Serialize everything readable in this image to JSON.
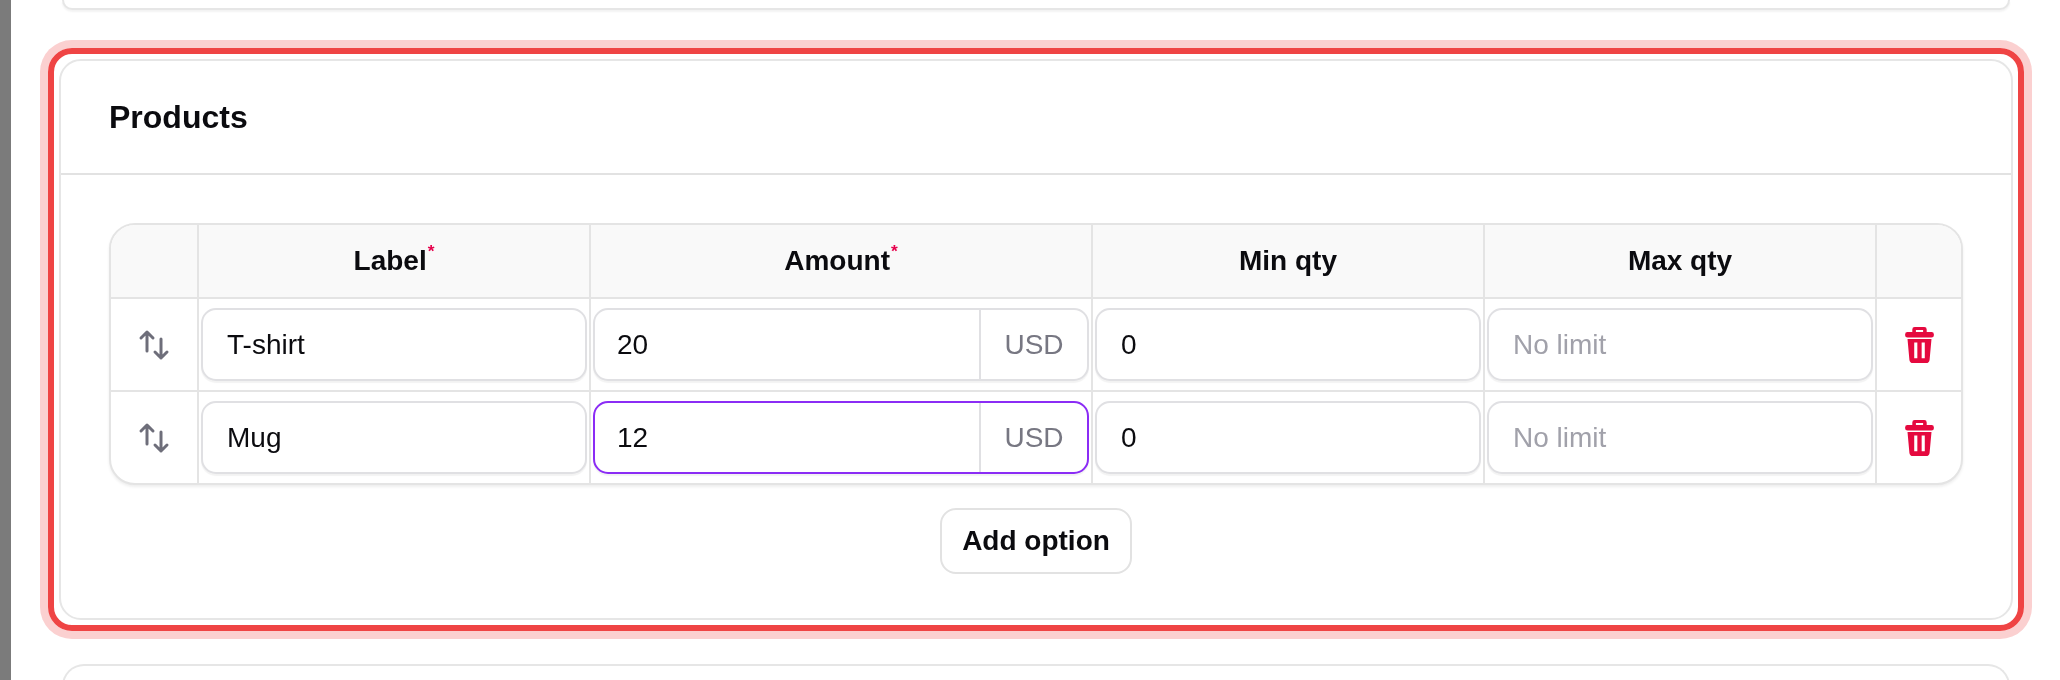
{
  "section": {
    "title": "Products",
    "highlighted": true
  },
  "table": {
    "columns": [
      {
        "label": "Label$^{*}$"
      },
      {
        "label": "Amount$^{*}$"
      },
      {
        "label": "Min qty"
      },
      {
        "label": "Max qty"
      }
    ],
    "rows": [
      {
        "label": {
          "value": "T-shirt"
        },
        "amount": {
          "value": "20",
          "unit": "USD",
          "focused": false
        },
        "min_qty": {
          "value": "0"
        },
        "max_qty": {
          "placeholder": "No limit"
        }
      },
      {
        "label": {
          "value": "Mug"
        },
        "amount": {
          "value": "12",
          "unit": "USD",
          "focused": true
        },
        "min_qty": {
          "value": "0"
        },
        "max_qty": {
          "placeholder": "No limit"
        }
      }
    ]
  },
  "add_button": {
    "label": "Add option"
  }
}
